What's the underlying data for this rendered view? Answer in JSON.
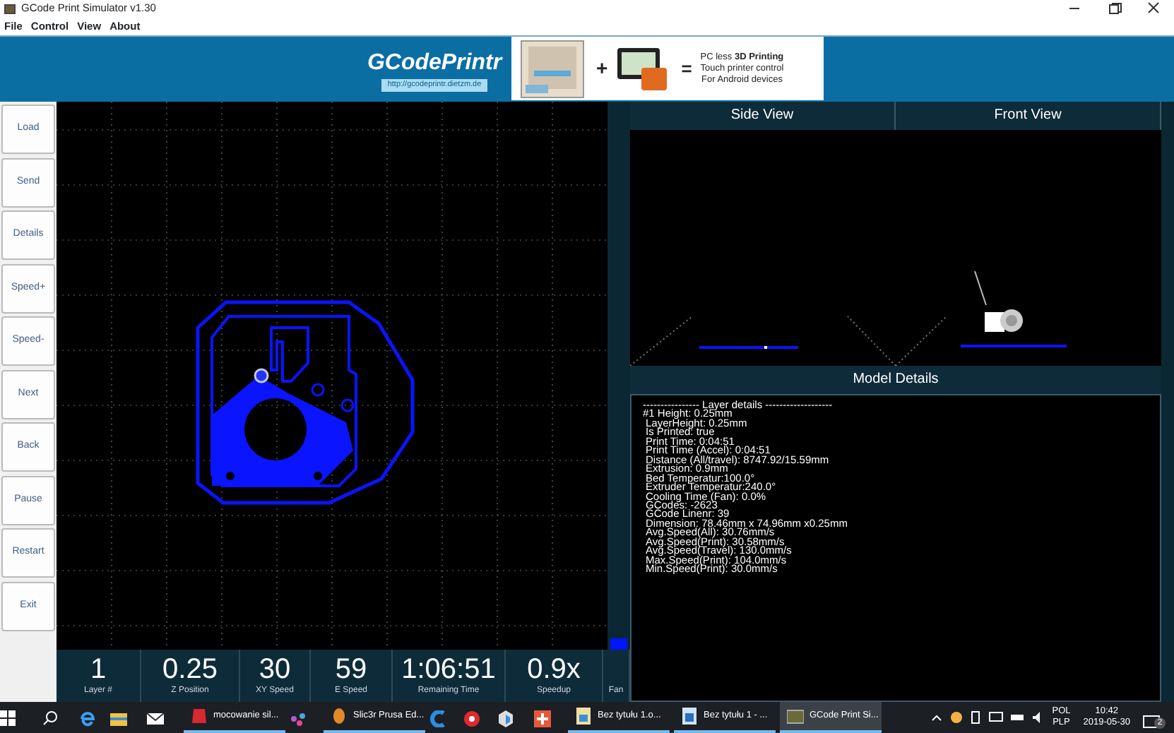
{
  "window": {
    "title": "GCode Print Simulator v1.30"
  },
  "menu": [
    {
      "label": "File"
    },
    {
      "label": "Control"
    },
    {
      "label": "View"
    },
    {
      "label": "About"
    }
  ],
  "banner": {
    "logo": "GCodePrintr",
    "url": "http://gcodeprintr.dietzm.de",
    "plus": "+",
    "equals": "=",
    "ad_lines": [
      "PC less **3D Printing**",
      "Touch printer control",
      "For Android devices"
    ]
  },
  "buttons": [
    {
      "label": "Load"
    },
    {
      "label": "Send"
    },
    {
      "label": "Details"
    },
    {
      "label": "Speed+"
    },
    {
      "label": "Speed-"
    },
    {
      "label": "Next"
    },
    {
      "label": "Back"
    },
    {
      "label": "Pause"
    },
    {
      "label": "Restart"
    },
    {
      "label": "Exit"
    }
  ],
  "views": [
    {
      "title": "Side View",
      "kind": "side"
    },
    {
      "title": "Front View",
      "kind": "front"
    }
  ],
  "model_details": {
    "title": "Model Details",
    "lines": [
      "---------------- Layer details -------------------",
      "#1 Height: 0.25mm",
      "LayerHeight: 0.25mm",
      "Is Printed: true",
      "Print Time: 0:04:51",
      "Print Time (Accel): 0:04:51",
      "Distance (All/travel): 8747.92/15.59mm",
      "Extrusion: 0.9mm",
      "Bed Temperatur:100.0°",
      "Extruder Temperatur:240.0°",
      "Cooling Time (Fan): 0.0%",
      "GCodes: -2623",
      "GCode Linenr: 39",
      "Dimension: 78.46mm x 74.96mm x0.25mm",
      "Avg.Speed(All): 30.76mm/s",
      "Avg.Speed(Print): 30.58mm/s",
      "Avg.Speed(Travel): 130.0mm/s",
      "Max.Speed(Print): 104.0mm/s",
      "Min.Speed(Print): 30.0mm/s"
    ]
  },
  "stats": [
    {
      "value": "1",
      "label": "Layer #"
    },
    {
      "value": "0.25",
      "label": "Z Position"
    },
    {
      "value": "30",
      "label": "XY Speed"
    },
    {
      "value": "59",
      "label": "E Speed"
    },
    {
      "value": "1:06:51",
      "label": "Remaining Time"
    },
    {
      "value": "0.9x",
      "label": "Speedup"
    }
  ],
  "fan": {
    "label": "Fan",
    "level": 0.02
  },
  "taskbar": {
    "items": [
      {
        "kind": "pinned"
      },
      {
        "kind": "pinned"
      },
      {
        "kind": "pinned"
      },
      {
        "kind": "window",
        "label": "mocowanie sil...",
        "selected": false
      },
      {
        "kind": "pinned"
      },
      {
        "kind": "window",
        "label": "Slic3r Prusa Ed...",
        "selected": false
      },
      {
        "kind": "pinned"
      },
      {
        "kind": "pinned"
      },
      {
        "kind": "pinned"
      },
      {
        "kind": "pinned"
      },
      {
        "kind": "window",
        "label": "Bez tytułu 1.o...",
        "selected": false
      },
      {
        "kind": "window",
        "label": "Bez tytułu 1 - ...",
        "selected": false
      },
      {
        "kind": "window",
        "label": "GCode Print Si...",
        "selected": true
      }
    ],
    "language": [
      "POL",
      "PLP"
    ],
    "time": "10:42",
    "date": "2019-05-30",
    "notifications": "2"
  }
}
